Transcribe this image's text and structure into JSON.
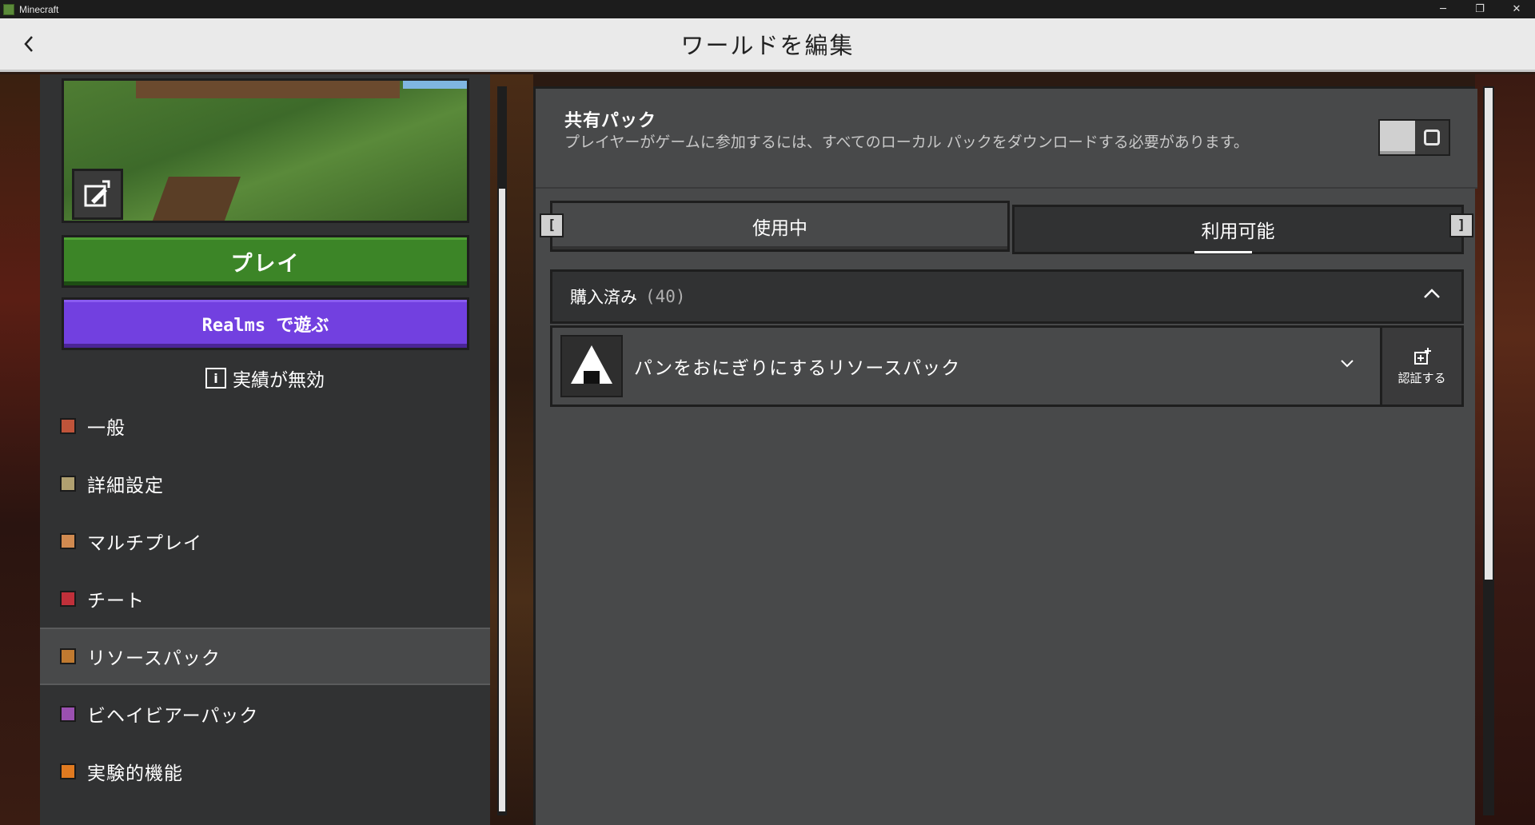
{
  "window": {
    "title": "Minecraft",
    "minimize": "─",
    "restore": "❐",
    "close": "✕"
  },
  "header": {
    "title": "ワールドを編集"
  },
  "left": {
    "play_label": "プレイ",
    "realms_label": "Realms で遊ぶ",
    "achievements_label": "実績が無効",
    "nav": [
      {
        "label": "一般",
        "icon": "general-icon",
        "color": "#c0543a"
      },
      {
        "label": "詳細設定",
        "icon": "advanced-icon",
        "color": "#b0a070"
      },
      {
        "label": "マルチプレイ",
        "icon": "multiplayer-icon",
        "color": "#d08a50"
      },
      {
        "label": "チート",
        "icon": "cheats-icon",
        "color": "#c0303a"
      },
      {
        "label": "リソースパック",
        "icon": "resource-pack-icon",
        "color": "#c07a30"
      },
      {
        "label": "ビヘイビアーパック",
        "icon": "behavior-pack-icon",
        "color": "#9a50b0"
      },
      {
        "label": "実験的機能",
        "icon": "experimental-icon",
        "color": "#e07a20"
      }
    ]
  },
  "right": {
    "shared_title": "共有パック",
    "shared_desc": "プレイヤーがゲームに参加するには、すべてのローカル パックをダウンロードする必要があります。",
    "tab_inuse": "使用中",
    "tab_available": "利用可能",
    "bracket_left": "[",
    "bracket_right": "]",
    "purchased_label": "購入済み",
    "purchased_count": "(40)",
    "pack_name": "パンをおにぎりにするリソースパック",
    "verify_label": "認証する"
  },
  "colors": {
    "play": "#3c8527",
    "realms": "#7240e0",
    "panel": "#313233"
  }
}
